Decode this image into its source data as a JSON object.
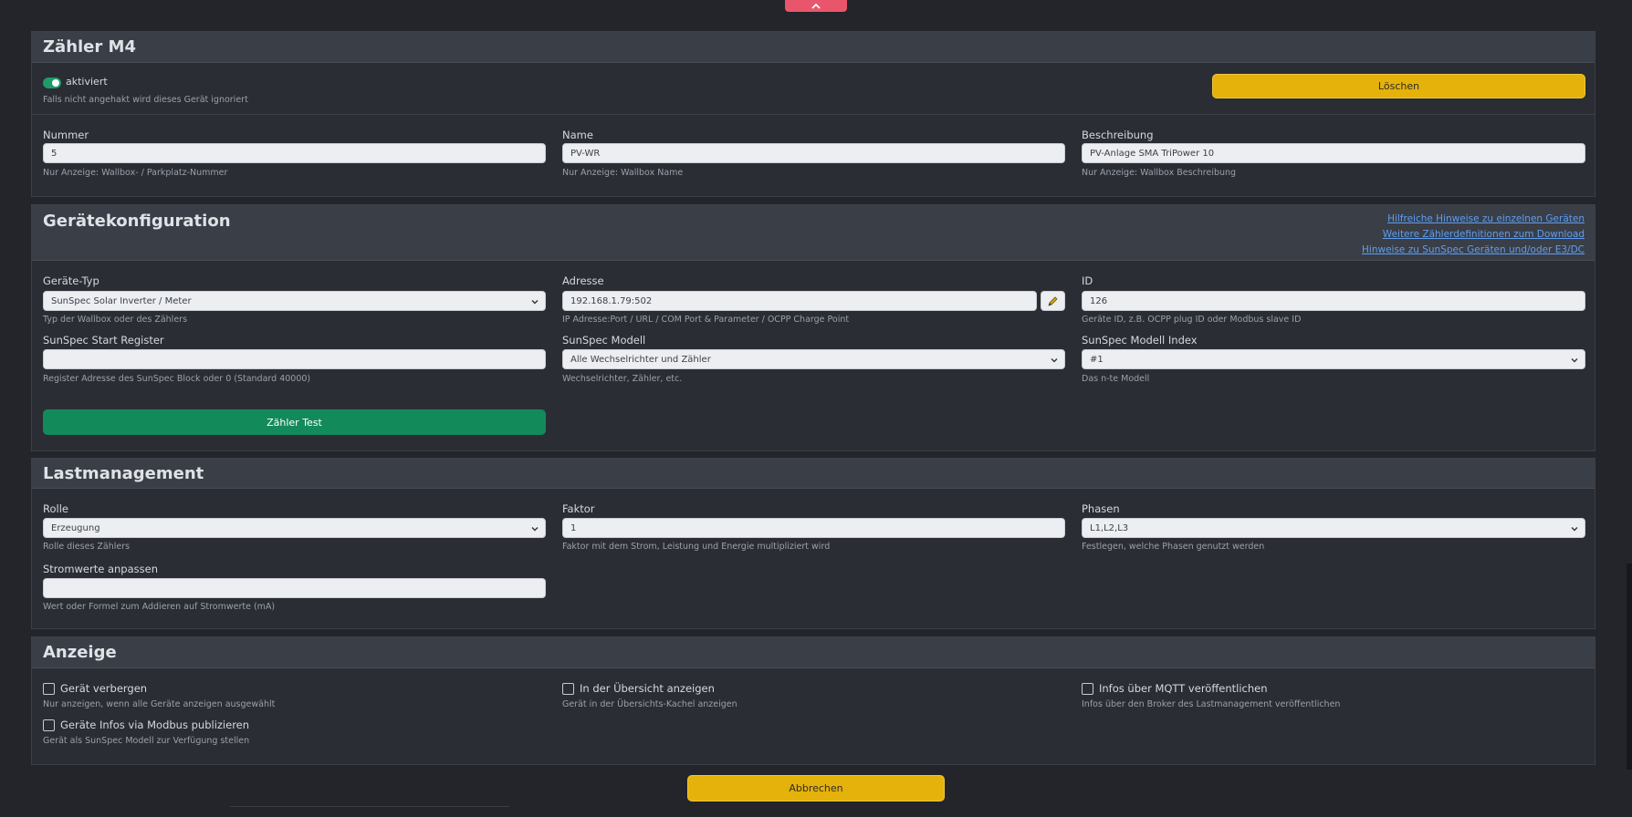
{
  "meter": {
    "title": "Zähler M4",
    "enabled_label": "aktiviert",
    "enabled_help": "Falls nicht angehakt wird dieses Gerät ignoriert",
    "delete_label": "Löschen",
    "number": {
      "label": "Nummer",
      "value": "5",
      "help": "Nur Anzeige: Wallbox- / Parkplatz-Nummer"
    },
    "name": {
      "label": "Name",
      "value": "PV-WR",
      "help": "Nur Anzeige: Wallbox Name"
    },
    "description": {
      "label": "Beschreibung",
      "value": "PV-Anlage SMA TriPower 10",
      "help": "Nur Anzeige: Wallbox Beschreibung"
    }
  },
  "device_config": {
    "title": "Gerätekonfiguration",
    "links": [
      "Hilfreiche Hinweise zu einzelnen Geräten",
      "Weitere Zählerdefinitionen zum Download",
      "Hinweise zu SunSpec Geräten und/oder E3/DC"
    ],
    "device_type": {
      "label": "Geräte-Typ",
      "value": "SunSpec Solar Inverter / Meter",
      "help": "Typ der Wallbox oder des Zählers"
    },
    "address": {
      "label": "Adresse",
      "value": "192.168.1.79:502",
      "help": "IP Adresse:Port / URL / COM Port & Parameter / OCPP Charge Point"
    },
    "id": {
      "label": "ID",
      "value": "126",
      "help": "Geräte ID, z.B. OCPP plug ID oder Modbus slave ID"
    },
    "start_register": {
      "label": "SunSpec Start Register",
      "value": "",
      "help": "Register Adresse des SunSpec Block oder 0 (Standard 40000)"
    },
    "model": {
      "label": "SunSpec Modell",
      "value": "Alle Wechselrichter und Zähler",
      "help": "Wechselrichter, Zähler, etc."
    },
    "model_index": {
      "label": "SunSpec Modell Index",
      "value": "#1",
      "help": "Das n-te Modell"
    },
    "test_label": "Zähler Test"
  },
  "load_management": {
    "title": "Lastmanagement",
    "role": {
      "label": "Rolle",
      "value": "Erzeugung",
      "help": "Rolle dieses Zählers"
    },
    "factor": {
      "label": "Faktor",
      "value": "1",
      "help": "Faktor mit dem Strom, Leistung und Energie multipliziert wird"
    },
    "phases": {
      "label": "Phasen",
      "value": "L1,L2,L3",
      "help": "Festlegen, welche Phasen genutzt werden"
    },
    "current_adjust": {
      "label": "Stromwerte anpassen",
      "value": "",
      "help": "Wert oder Formel zum Addieren auf Stromwerte (mA)"
    }
  },
  "display": {
    "title": "Anzeige",
    "hide": {
      "label": "Gerät verbergen",
      "help": "Nur anzeigen, wenn alle Geräte anzeigen ausgewählt"
    },
    "overview": {
      "label": "In der Übersicht anzeigen",
      "help": "Gerät in der Übersichts-Kachel anzeigen"
    },
    "mqtt": {
      "label": "Infos über MQTT veröffentlichen",
      "help": "Infos über den Broker des Lastmanagement veröffentlichen"
    },
    "modbus": {
      "label": "Geräte Infos via Modbus publizieren",
      "help": "Gerät als SunSpec Modell zur Verfügung stellen"
    }
  },
  "cancel_label": "Abbrechen",
  "colors": {
    "accent_yellow": "#e5b20b",
    "accent_green": "#128a5a",
    "accent_red": "#e9566b",
    "link_blue": "#5e9ef0"
  }
}
